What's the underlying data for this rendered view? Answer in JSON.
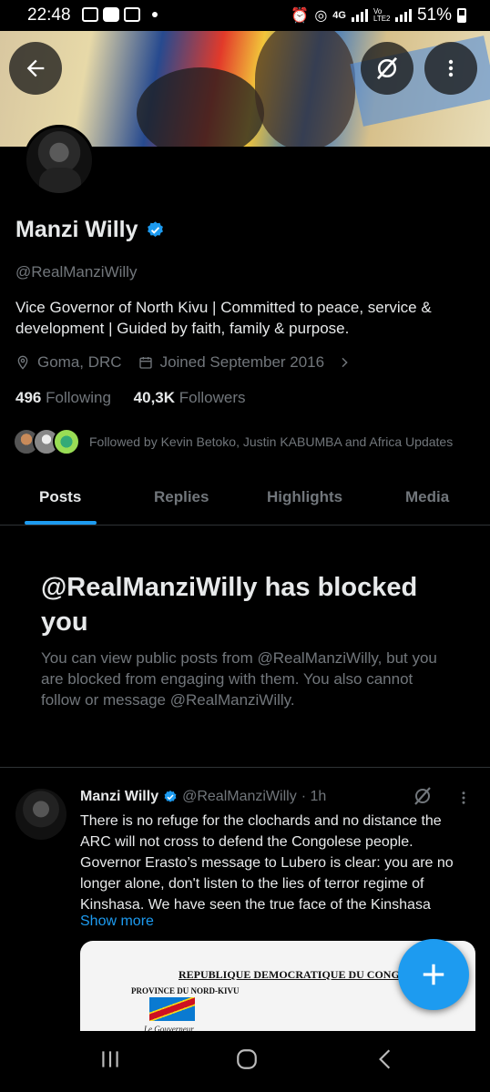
{
  "status_bar": {
    "time": "22:48",
    "network_4g": "4G",
    "volte": "Vo LTE2",
    "battery": "51%"
  },
  "profile": {
    "name": "Manzi Willy",
    "handle": "@RealManziWilly",
    "bio": "Vice Governor of North Kivu | Committed to peace, service & development | Guided by faith, family & purpose.",
    "location": "Goma, DRC",
    "joined": "Joined September 2016",
    "following_count": "496",
    "following_label": "Following",
    "followers_count": "40,3K",
    "followers_label": "Followers",
    "followed_by": "Followed by Kevin Betoko, Justin KABUMBA and Africa Updates",
    "verified_color": "#1d9bf0"
  },
  "tabs": [
    {
      "label": "Posts",
      "active": true
    },
    {
      "label": "Replies",
      "active": false
    },
    {
      "label": "Highlights",
      "active": false
    },
    {
      "label": "Media",
      "active": false
    }
  ],
  "blocked": {
    "title": "@RealManziWilly has blocked you",
    "message": "You can view public posts from @RealManziWilly, but you are blocked from engaging with them. You also cannot follow or message @RealManziWilly."
  },
  "post": {
    "author_name": "Manzi Willy",
    "author_handle": "@RealManziWilly",
    "time": "· 1h",
    "text": "There is no refuge for the clochards and no distance the ARC will not cross to defend the Congolese people. Governor Erasto’s message to Lubero is clear: you are no longer alone, don't listen to the lies of terror regime of Kinshasa. We have seen the true face of the Kinshasa",
    "show_more": "Show more",
    "image": {
      "title": "REPUBLIQUE DEMOCRATIQUE DU CONGO",
      "subtitle": "PROVINCE DU NORD-KIVU",
      "line": "Le Gouverneur"
    }
  },
  "icons": {
    "back": "arrow-left-icon",
    "grok": "grok-icon",
    "more": "more-vertical-icon",
    "location": "location-pin-icon",
    "calendar": "calendar-icon",
    "compose": "plus-icon"
  },
  "colors": {
    "accent": "#1d9bf0",
    "muted": "#71767b",
    "text": "#e7e9ea",
    "background": "#000000"
  }
}
